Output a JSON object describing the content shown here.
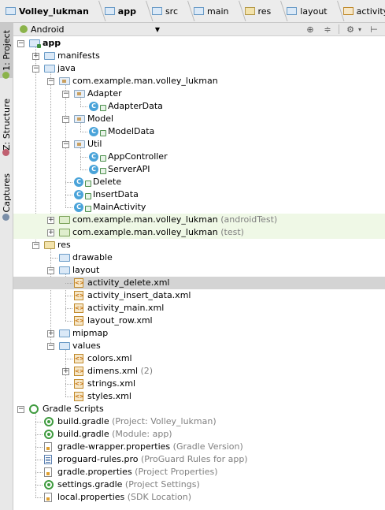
{
  "breadcrumbs": [
    {
      "label": "Volley_lukman",
      "icon": "project-folder-icon",
      "bold": true
    },
    {
      "label": "app",
      "icon": "module-folder-icon",
      "bold": true
    },
    {
      "label": "src",
      "icon": "folder-icon",
      "bold": false
    },
    {
      "label": "main",
      "icon": "folder-icon",
      "bold": false
    },
    {
      "label": "res",
      "icon": "res-folder-icon",
      "bold": false
    },
    {
      "label": "layout",
      "icon": "folder-icon",
      "bold": false
    },
    {
      "label": "activity_delete.xm",
      "icon": "xml-file-icon",
      "bold": false
    }
  ],
  "side_tabs": [
    {
      "label": "1: Project",
      "active": true,
      "icon": "android-icon"
    },
    {
      "label": "Z: Structure",
      "active": false,
      "icon": "structure-icon"
    },
    {
      "label": "Captures",
      "active": false,
      "icon": "captures-icon"
    }
  ],
  "toolbar": {
    "view_mode": "Android",
    "buttons": [
      "sync-target-icon",
      "collapse-all-icon",
      "gear-icon",
      "hide-panel-icon"
    ]
  },
  "colors": {
    "selection": "#d4d4d4",
    "test_highlight": "#eff8e6",
    "hint_text": "#808080"
  },
  "tree": [
    {
      "label": "app",
      "hint": "",
      "indent": 0,
      "toggle": "-",
      "icon": "app",
      "bold": true
    },
    {
      "label": "manifests",
      "hint": "",
      "indent": 1,
      "toggle": "+",
      "icon": "folder"
    },
    {
      "label": "java",
      "hint": "",
      "indent": 1,
      "toggle": "-",
      "icon": "folder"
    },
    {
      "label": "com.example.man.volley_lukman",
      "hint": "",
      "indent": 2,
      "toggle": "-",
      "icon": "pkg"
    },
    {
      "label": "Adapter",
      "hint": "",
      "indent": 3,
      "toggle": "-",
      "icon": "pkg"
    },
    {
      "label": "AdapterData",
      "hint": "",
      "indent": 4,
      "toggle": "",
      "icon": "class"
    },
    {
      "label": "Model",
      "hint": "",
      "indent": 3,
      "toggle": "-",
      "icon": "pkg"
    },
    {
      "label": "ModelData",
      "hint": "",
      "indent": 4,
      "toggle": "",
      "icon": "class"
    },
    {
      "label": "Util",
      "hint": "",
      "indent": 3,
      "toggle": "-",
      "icon": "pkg"
    },
    {
      "label": "AppController",
      "hint": "",
      "indent": 4,
      "toggle": "",
      "icon": "class"
    },
    {
      "label": "ServerAPI",
      "hint": "",
      "indent": 4,
      "toggle": "",
      "icon": "class"
    },
    {
      "label": "Delete",
      "hint": "",
      "indent": 3,
      "toggle": "",
      "icon": "class"
    },
    {
      "label": "InsertData",
      "hint": "",
      "indent": 3,
      "toggle": "",
      "icon": "class"
    },
    {
      "label": "MainActivity",
      "hint": "",
      "indent": 3,
      "toggle": "",
      "icon": "class"
    },
    {
      "label": "com.example.man.volley_lukman",
      "hint": "(androidTest)",
      "indent": 2,
      "toggle": "+",
      "icon": "test",
      "highlight": true
    },
    {
      "label": "com.example.man.volley_lukman",
      "hint": "(test)",
      "indent": 2,
      "toggle": "+",
      "icon": "test",
      "highlight": true
    },
    {
      "label": "res",
      "hint": "",
      "indent": 1,
      "toggle": "-",
      "icon": "res"
    },
    {
      "label": "drawable",
      "hint": "",
      "indent": 2,
      "toggle": "",
      "icon": "folder"
    },
    {
      "label": "layout",
      "hint": "",
      "indent": 2,
      "toggle": "-",
      "icon": "folder"
    },
    {
      "label": "activity_delete.xml",
      "hint": "",
      "indent": 3,
      "toggle": "",
      "icon": "xml",
      "selected": true
    },
    {
      "label": "activity_insert_data.xml",
      "hint": "",
      "indent": 3,
      "toggle": "",
      "icon": "xml"
    },
    {
      "label": "activity_main.xml",
      "hint": "",
      "indent": 3,
      "toggle": "",
      "icon": "xml"
    },
    {
      "label": "layout_row.xml",
      "hint": "",
      "indent": 3,
      "toggle": "",
      "icon": "xml"
    },
    {
      "label": "mipmap",
      "hint": "",
      "indent": 2,
      "toggle": "+",
      "icon": "folder"
    },
    {
      "label": "values",
      "hint": "",
      "indent": 2,
      "toggle": "-",
      "icon": "folder"
    },
    {
      "label": "colors.xml",
      "hint": "",
      "indent": 3,
      "toggle": "",
      "icon": "xml"
    },
    {
      "label": "dimens.xml",
      "hint": "(2)",
      "indent": 3,
      "toggle": "+",
      "icon": "xml"
    },
    {
      "label": "strings.xml",
      "hint": "",
      "indent": 3,
      "toggle": "",
      "icon": "xml"
    },
    {
      "label": "styles.xml",
      "hint": "",
      "indent": 3,
      "toggle": "",
      "icon": "xml"
    },
    {
      "label": "Gradle Scripts",
      "hint": "",
      "indent": 0,
      "toggle": "-",
      "icon": "scripts"
    },
    {
      "label": "build.gradle",
      "hint": "(Project: Volley_lukman)",
      "indent": 1,
      "toggle": "",
      "icon": "gradle"
    },
    {
      "label": "build.gradle",
      "hint": "(Module: app)",
      "indent": 1,
      "toggle": "",
      "icon": "gradle"
    },
    {
      "label": "gradle-wrapper.properties",
      "hint": "(Gradle Version)",
      "indent": 1,
      "toggle": "",
      "icon": "props"
    },
    {
      "label": "proguard-rules.pro",
      "hint": "(ProGuard Rules for app)",
      "indent": 1,
      "toggle": "",
      "icon": "pro"
    },
    {
      "label": "gradle.properties",
      "hint": "(Project Properties)",
      "indent": 1,
      "toggle": "",
      "icon": "props"
    },
    {
      "label": "settings.gradle",
      "hint": "(Project Settings)",
      "indent": 1,
      "toggle": "",
      "icon": "gradle"
    },
    {
      "label": "local.properties",
      "hint": "(SDK Location)",
      "indent": 1,
      "toggle": "",
      "icon": "props"
    }
  ]
}
